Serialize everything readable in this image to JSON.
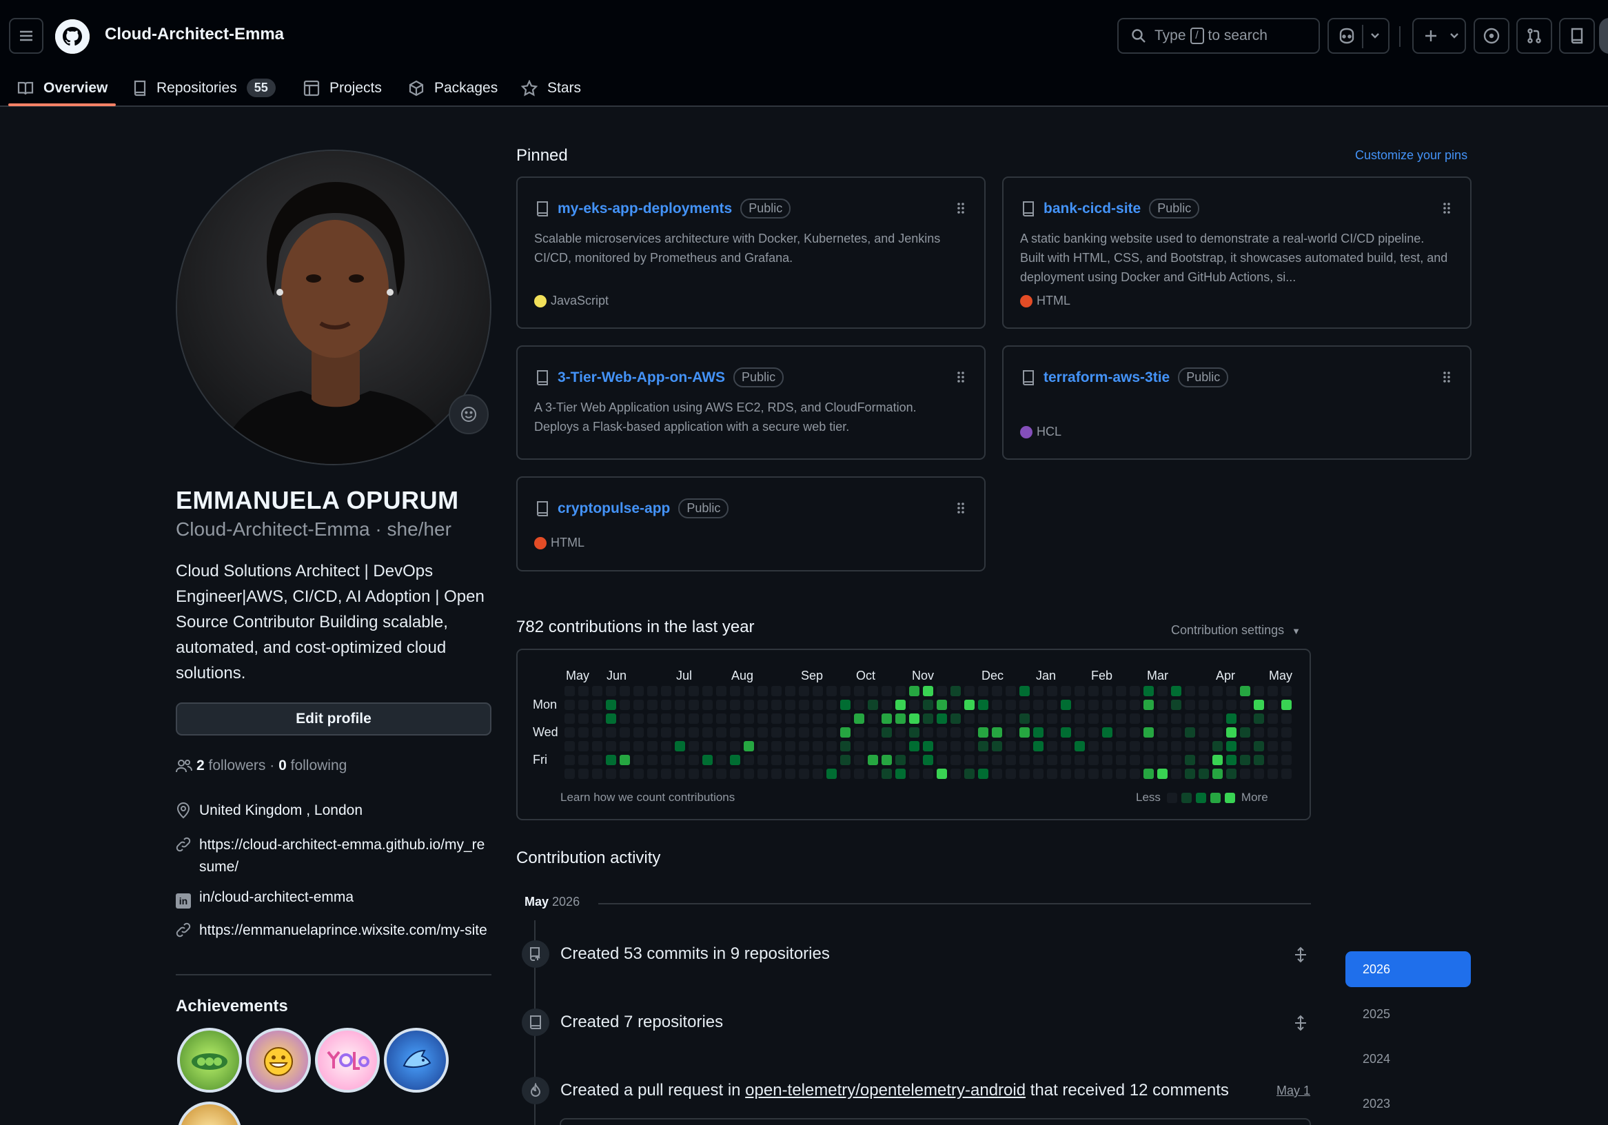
{
  "header": {
    "username": "Cloud-Architect-Emma",
    "search_prefix": "Type",
    "search_key": "/",
    "search_suffix": "to search"
  },
  "tabs": [
    {
      "label": "Overview"
    },
    {
      "label": "Repositories",
      "count": "55"
    },
    {
      "label": "Projects"
    },
    {
      "label": "Packages"
    },
    {
      "label": "Stars"
    }
  ],
  "profile": {
    "name": "EMMANUELA OPURUM",
    "login_line": "Cloud-Architect-Emma · she/her",
    "bio": "Cloud Solutions Architect | DevOps Engineer|AWS, CI/CD, AI Adoption | Open Source Contributor Building scalable, automated, and cost-optimized cloud solutions.",
    "edit_label": "Edit profile",
    "followers_count": "2",
    "followers_label": "followers",
    "following_count": "0",
    "following_label": "following",
    "location": "United Kingdom , London",
    "website1": "https://cloud-architect-emma.github.io/my_resume/",
    "linkedin": "in/cloud-architect-emma",
    "website2": "https://emmanuelaprince.wixsite.com/my-site",
    "achievements_title": "Achievements"
  },
  "pinned": {
    "title": "Pinned",
    "customize": "Customize your pins",
    "cards": [
      {
        "name": "my-eks-app-deployments",
        "visibility": "Public",
        "desc_lines": [
          "Scalable microservices architecture with Docker, Kubernetes, and Jenkins",
          "CI/CD, monitored by Prometheus and Grafana."
        ],
        "language": "JavaScript",
        "lang_color": "#f1e05a"
      },
      {
        "name": "bank-cicd-site",
        "visibility": "Public",
        "desc_lines": [
          "A static banking website used to demonstrate a real-world CI/CD pipeline.",
          "Built with HTML, CSS, and Bootstrap, it showcases automated build, test, and",
          "deployment using Docker and GitHub Actions, si..."
        ],
        "language": "HTML",
        "lang_color": "#e34c26"
      },
      {
        "name": "3-Tier-Web-App-on-AWS",
        "visibility": "Public",
        "desc_lines": [
          "A 3-Tier Web Application using AWS EC2, RDS, and CloudFormation.",
          "Deploys a Flask-based application with a secure web tier."
        ],
        "language": "",
        "lang_color": ""
      },
      {
        "name": "terraform-aws-3tie",
        "visibility": "Public",
        "desc_lines": [],
        "language": "HCL",
        "lang_color": "#844fba"
      },
      {
        "name": "cryptopulse-app",
        "visibility": "Public",
        "desc_lines": [],
        "language": "HTML",
        "lang_color": "#e34c26"
      }
    ]
  },
  "contributions": {
    "title": "782 contributions in the last year",
    "settings": "Contribution settings",
    "months": [
      "May",
      "Jun",
      "Jul",
      "Aug",
      "Sep",
      "Oct",
      "Nov",
      "Dec",
      "Jan",
      "Feb",
      "Mar",
      "Apr",
      "May"
    ],
    "days": [
      "Mon",
      "Wed",
      "Fri"
    ],
    "learn": "Learn how we count contributions",
    "less": "Less",
    "more": "More",
    "colors": [
      "#161b22",
      "#0e4429",
      "#006d32",
      "#26a641",
      "#39d353"
    ]
  },
  "activity": {
    "title": "Contribution activity",
    "month": "May",
    "year": "2026",
    "items": [
      {
        "text": "Created 53 commits in 9 repositories"
      },
      {
        "text": "Created 7 repositories"
      },
      {
        "prefix": "Created a pull request in",
        "link": "open-telemetry/opentelemetry-android",
        "suffix": "that received 12 comments",
        "date": "May 1"
      }
    ],
    "years": [
      "2026",
      "2025",
      "2024",
      "2023"
    ]
  }
}
